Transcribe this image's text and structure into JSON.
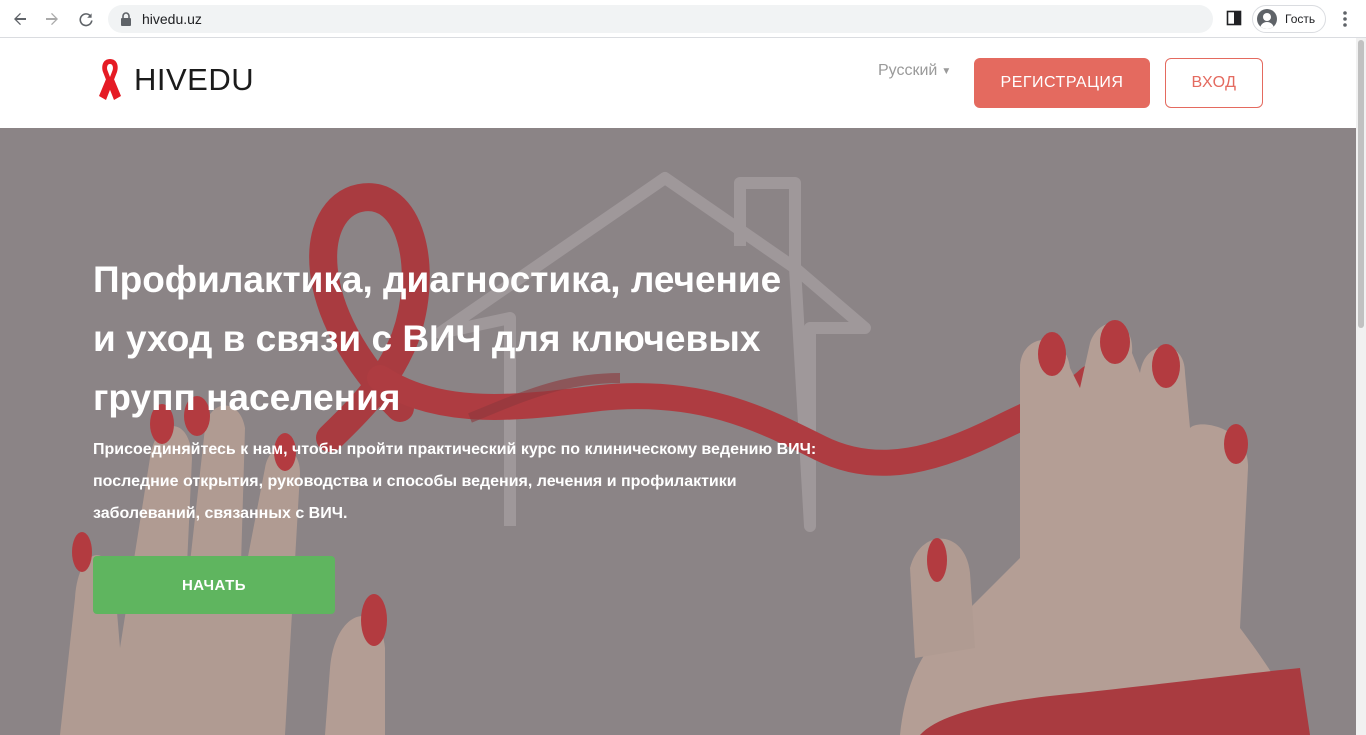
{
  "browser": {
    "url": "hivedu.uz",
    "profile_label": "Гость"
  },
  "header": {
    "logo_text": "HIVEDU",
    "language": "Русский",
    "register_label": "РЕГИСТРАЦИЯ",
    "login_label": "ВХОД"
  },
  "hero": {
    "title": "Профилактика, диагностика, лечение и уход в связи с ВИЧ для ключевых групп населения",
    "description": "Присоединяйтесь к нам, чтобы пройти практический курс по клиническому ведению ВИЧ: последние открытия, руководства и способы ведения, лечения и профилактики заболеваний, связанных с ВИЧ.",
    "start_label": "НАЧАТЬ"
  },
  "colors": {
    "accent": "#e46a5f",
    "start_button": "#5fb55f",
    "hero_overlay": "#8b8486",
    "ribbon": "#c0161c"
  },
  "icons": [
    "back-icon",
    "forward-icon",
    "reload-icon",
    "lock-icon",
    "side-panel-icon",
    "profile-icon",
    "menu-icon",
    "ribbon-logo-icon",
    "caret-down-icon"
  ]
}
